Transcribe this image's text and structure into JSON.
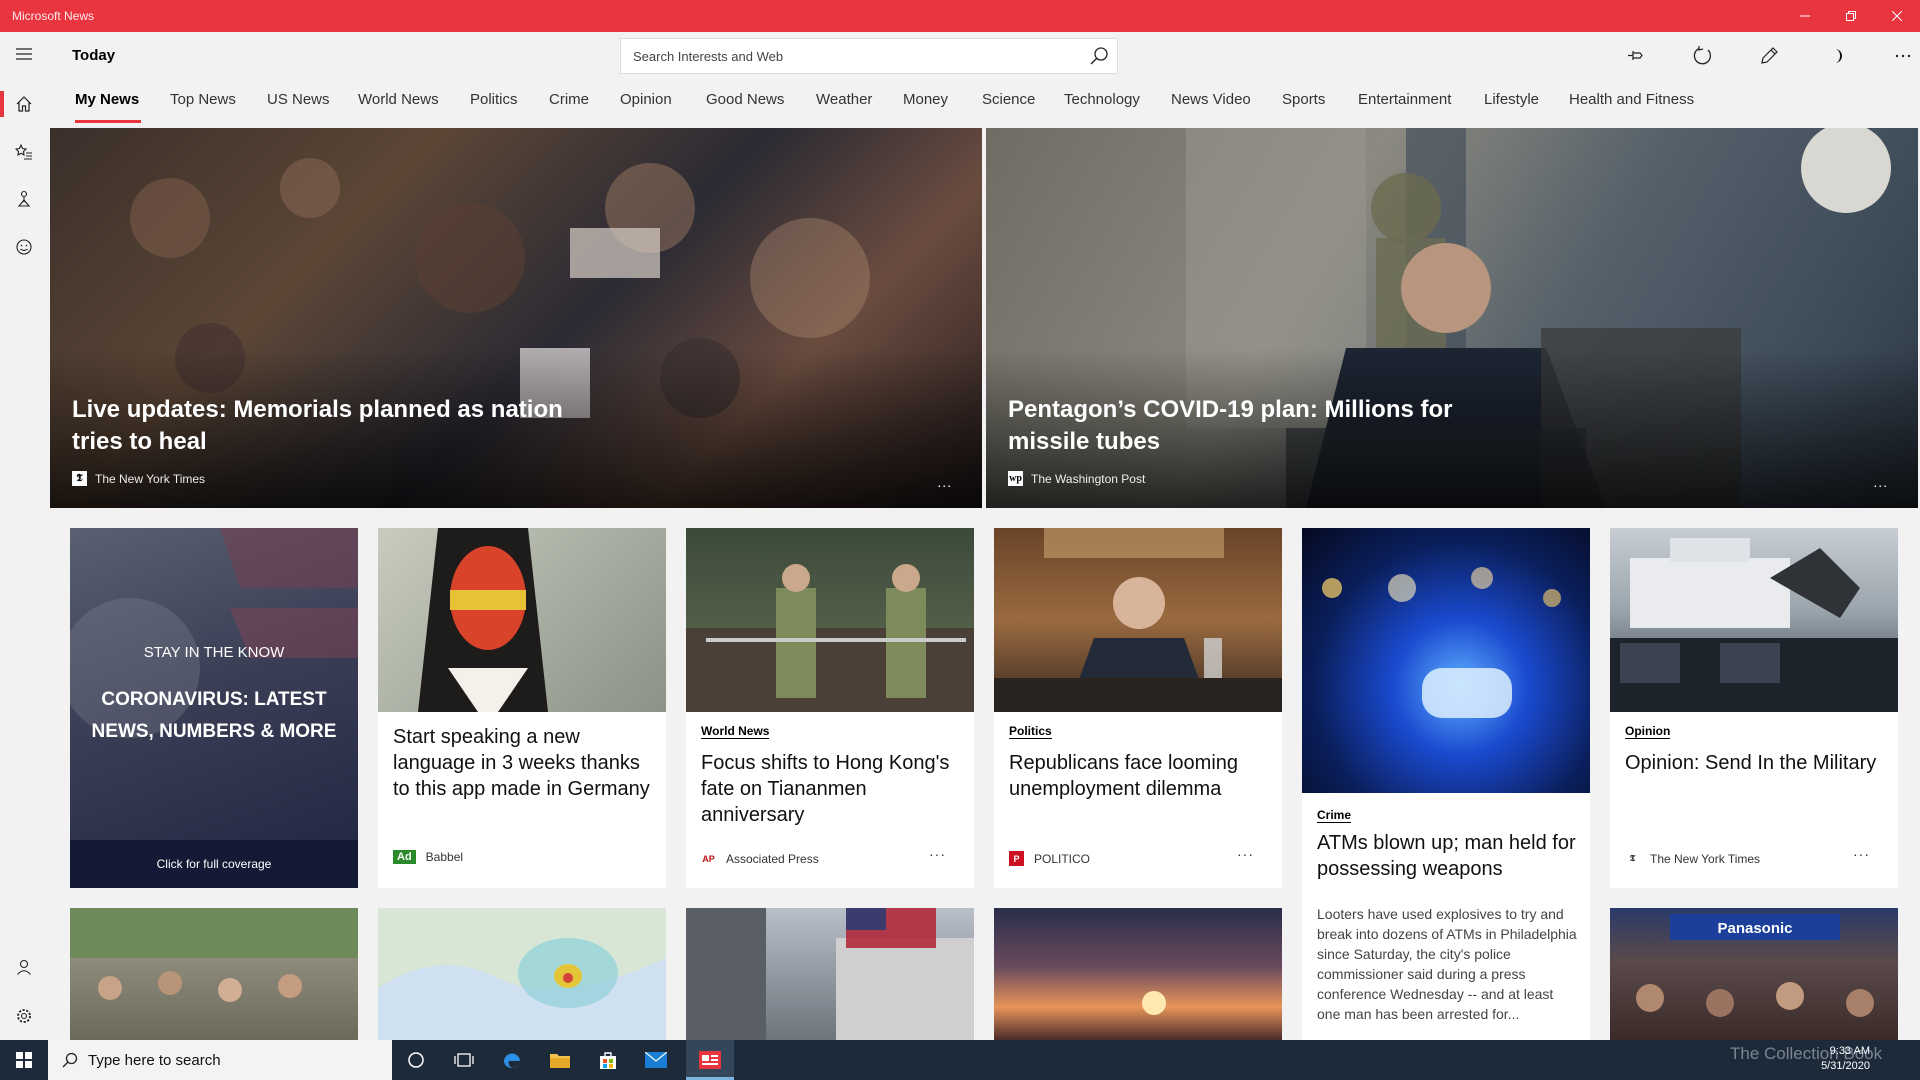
{
  "window": {
    "title": "Microsoft News"
  },
  "header": {
    "page_title": "Today",
    "search_placeholder": "Search Interests and Web"
  },
  "tabs": [
    {
      "label": "My News",
      "active": true
    },
    {
      "label": "Top News"
    },
    {
      "label": "US News"
    },
    {
      "label": "World News"
    },
    {
      "label": "Politics"
    },
    {
      "label": "Crime"
    },
    {
      "label": "Opinion"
    },
    {
      "label": "Good News"
    },
    {
      "label": "Weather"
    },
    {
      "label": "Money"
    },
    {
      "label": "Science"
    },
    {
      "label": "Technology"
    },
    {
      "label": "News Video"
    },
    {
      "label": "Sports"
    },
    {
      "label": "Entertainment"
    },
    {
      "label": "Lifestyle"
    },
    {
      "label": "Health and Fitness"
    }
  ],
  "hero": [
    {
      "title": "Live updates: Memorials planned as nation tries to heal",
      "source": "The New York Times"
    },
    {
      "title": "Pentagon’s COVID-19 plan: Millions for missile tubes",
      "source": "The Washington Post"
    }
  ],
  "promo": {
    "kicker": "STAY IN THE KNOW",
    "headline": "CORONAVIRUS: LATEST NEWS, NUMBERS & MORE",
    "cta": "Click for full coverage"
  },
  "cards": [
    {
      "category": "",
      "title": "Start speaking a new language in 3 weeks thanks to this app made in Germany",
      "badge": "Ad",
      "source": "Babbel"
    },
    {
      "category": "World News",
      "title": "Focus shifts to Hong Kong's fate on Tiananmen anniversary",
      "source": "Associated Press"
    },
    {
      "category": "Politics",
      "title": "Republicans face looming unemployment dilemma",
      "source": "POLITICO"
    },
    {
      "category": "Crime",
      "title": "ATMs blown up; man held for possessing weapons",
      "abstract": "Looters have used explosives to try and break into dozens of ATMs in Philadelphia since Saturday, the city's police commissioner said during a press conference Wednesday -- and at least one man has been arrested for..."
    },
    {
      "category": "Opinion",
      "title": "Opinion: Send In the Military",
      "source": "The New York Times"
    }
  ],
  "taskbar": {
    "search_placeholder": "Type here to search",
    "time": "9:33 AM",
    "date": "5/31/2020",
    "watermark": "The Collection Book"
  },
  "colors": {
    "accent": "#e83540",
    "taskbar": "#1c2a3a"
  }
}
